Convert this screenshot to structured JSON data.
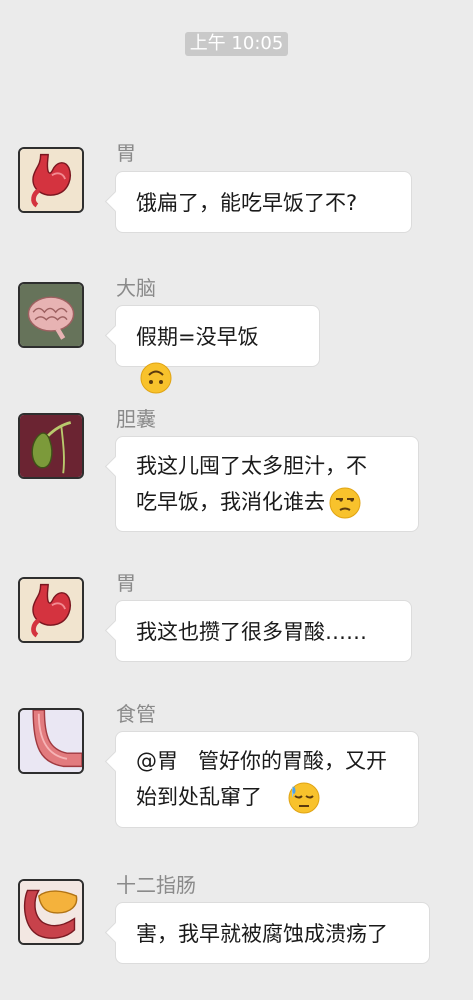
{
  "timestamp": "上午 10:05",
  "messages": [
    {
      "sender": "胃",
      "text": "饿扁了，能吃早饭了不?",
      "avatar": "stomach-avatar",
      "emoji": null
    },
    {
      "sender": "大脑",
      "text": "假期=没早饭",
      "avatar": "brain-avatar",
      "emoji": "upside-down-face-emoji"
    },
    {
      "sender": "胆囊",
      "text_lines": [
        "我这儿囤了太多胆汁，不",
        "吃早饭，我消化谁去"
      ],
      "avatar": "gallbladder-avatar",
      "emoji": "unamused-face-emoji"
    },
    {
      "sender": "胃",
      "text": "我这也攒了很多胃酸……",
      "avatar": "stomach-avatar",
      "emoji": null
    },
    {
      "sender": "食管",
      "text_lines": [
        "@胃   管好你的胃酸，又开",
        "始到处乱窜了"
      ],
      "avatar": "esophagus-avatar",
      "emoji": "sweat-face-emoji"
    },
    {
      "sender": "十二指肠",
      "text": "害，我早就被腐蚀成溃疡了",
      "avatar": "duodenum-avatar",
      "emoji": null
    }
  ]
}
